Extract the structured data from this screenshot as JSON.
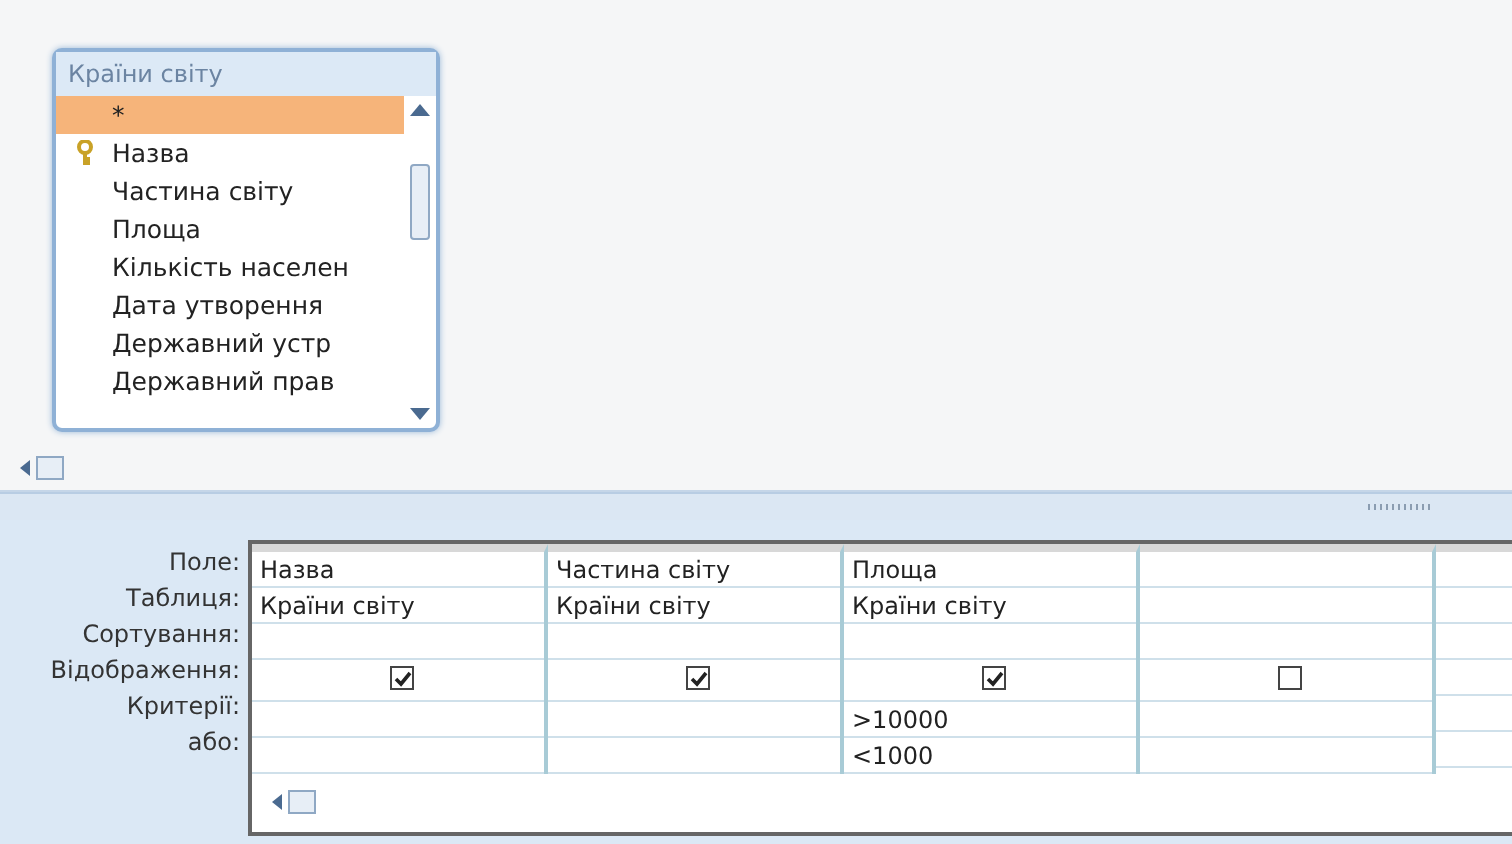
{
  "table_box": {
    "title": "Країни світу",
    "fields": [
      {
        "name": "*",
        "primary_key": false,
        "selected": true
      },
      {
        "name": "Назва",
        "primary_key": true,
        "selected": false
      },
      {
        "name": "Частина світу",
        "primary_key": false,
        "selected": false
      },
      {
        "name": "Площа",
        "primary_key": false,
        "selected": false
      },
      {
        "name": "Кількість населен",
        "primary_key": false,
        "selected": false
      },
      {
        "name": "Дата утворення",
        "primary_key": false,
        "selected": false
      },
      {
        "name": "Державний устр",
        "primary_key": false,
        "selected": false
      },
      {
        "name": "Державний прав",
        "primary_key": false,
        "selected": false
      }
    ]
  },
  "grid": {
    "row_labels": [
      "Поле:",
      "Таблиця:",
      "Сортування:",
      "Відображення:",
      "Критерії:",
      "або:"
    ],
    "columns": [
      {
        "field": "Назва",
        "table": "Країни світу",
        "show": true
      },
      {
        "field": "Частина світу",
        "table": "Країни світу",
        "show": true
      },
      {
        "field": "Площа",
        "table": "Країни світу",
        "show": true,
        "criteria": ">10000",
        "or": "<1000"
      },
      {
        "show": false
      },
      {}
    ]
  }
}
